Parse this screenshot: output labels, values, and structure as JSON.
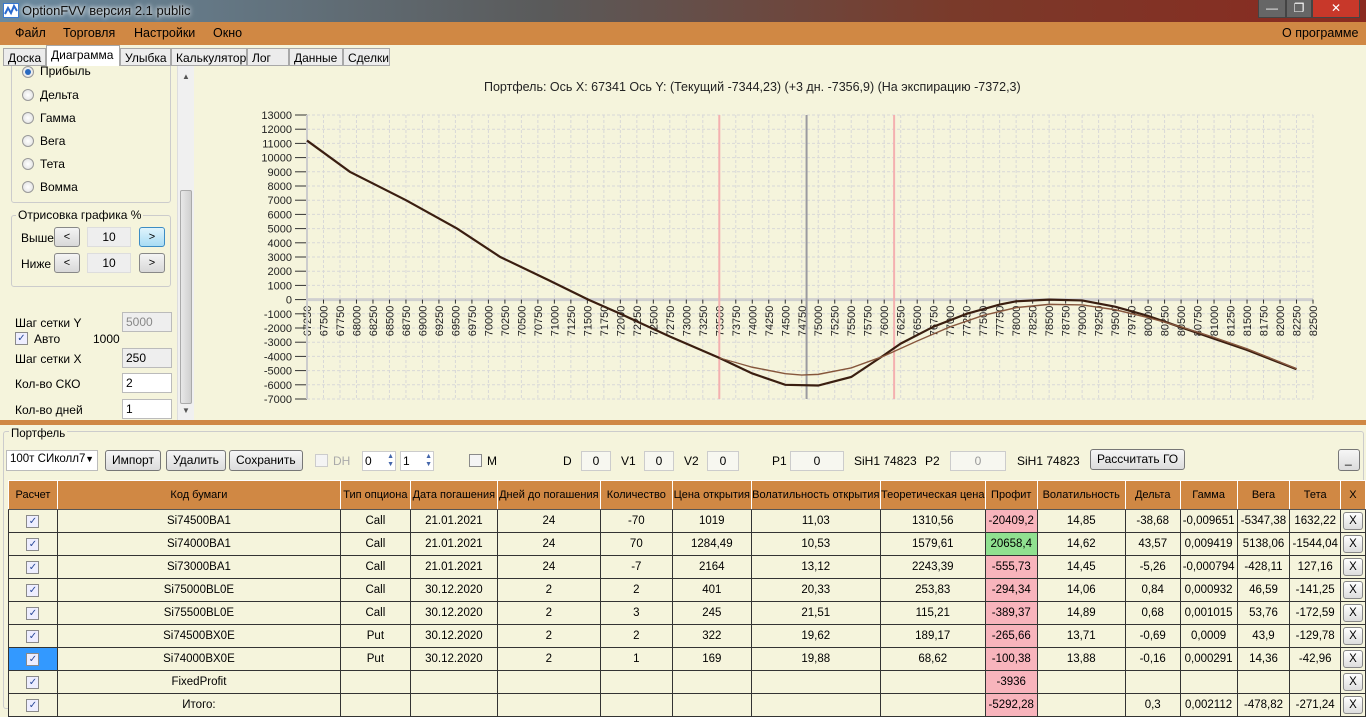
{
  "window": {
    "title": "OptionFVV версия 2.1 public",
    "icon": "app-chart-icon",
    "controls": [
      "minimize-icon",
      "maximize-icon",
      "close-icon"
    ]
  },
  "menu": {
    "items": [
      "Файл",
      "Торговля",
      "Настройки",
      "Окно"
    ],
    "about": "О программе"
  },
  "tabs": [
    "Доска",
    "Диаграмма",
    "Улыбка",
    "Калькулятор",
    "Лог",
    "Данные",
    "Сделки"
  ],
  "left": {
    "radios": [
      {
        "label": "Прибыль",
        "checked": true
      },
      {
        "label": "Дельта"
      },
      {
        "label": "Гамма"
      },
      {
        "label": "Вега"
      },
      {
        "label": "Тета"
      },
      {
        "label": "Вомма"
      }
    ],
    "draw_group": "Отрисовка графика %",
    "above": {
      "label": "Выше",
      "value": "10",
      "prev": "<",
      "next": ">"
    },
    "below": {
      "label": "Ниже",
      "value": "10",
      "prev": "<",
      "next": ">"
    },
    "grid_y": {
      "label": "Шаг сетки Y",
      "value": "5000"
    },
    "auto": {
      "label": "Авто",
      "value": "1000",
      "checked": true
    },
    "grid_x": {
      "label": "Шаг сетки X",
      "value": "250"
    },
    "sko": {
      "label": "Кол-во СКО",
      "value": "2"
    },
    "days": {
      "label": "Кол-во дней",
      "value": "1"
    }
  },
  "chart_header": "Портфель: Ось X: 67341 Ось Y:  (Текущий -7344,23)  (+3 дн. -7356,9)  (На экспирацию -7372,3)",
  "chart_data": {
    "type": "line",
    "title": "Портфель",
    "xlim": [
      67250,
      82500
    ],
    "xstep": 250,
    "ylim": [
      -7000,
      13000
    ],
    "ystep": 1000,
    "grid": true,
    "vlines": [
      {
        "x": 73500,
        "color": "#f4b0b0"
      },
      {
        "x": 74823,
        "color": "#9a9aa0"
      },
      {
        "x": 76150,
        "color": "#f4b0b0"
      }
    ],
    "series": [
      {
        "name": "На экспирацию",
        "color": "#3a1e10",
        "width": 2.2,
        "points": [
          [
            67250,
            11200
          ],
          [
            67900,
            9000
          ],
          [
            68750,
            7000
          ],
          [
            69525,
            5000
          ],
          [
            70180,
            3000
          ],
          [
            70900,
            1400
          ],
          [
            71514,
            0
          ],
          [
            72000,
            -1000
          ],
          [
            72750,
            -2600
          ],
          [
            73500,
            -4100
          ],
          [
            74000,
            -5200
          ],
          [
            74500,
            -6000
          ],
          [
            75000,
            -6050
          ],
          [
            75500,
            -5450
          ],
          [
            76000,
            -3900
          ],
          [
            76250,
            -3100
          ],
          [
            76750,
            -1900
          ],
          [
            77250,
            -1000
          ],
          [
            77750,
            -350
          ],
          [
            78000,
            -120
          ],
          [
            78500,
            0
          ],
          [
            79000,
            -60
          ],
          [
            79500,
            -500
          ],
          [
            80000,
            -1150
          ],
          [
            80500,
            -1950
          ],
          [
            81000,
            -2750
          ],
          [
            81500,
            -3550
          ],
          [
            82250,
            -4900
          ]
        ]
      },
      {
        "name": "Текущий",
        "color": "#7a4a30",
        "width": 1,
        "points": [
          [
            73500,
            -4100
          ],
          [
            74000,
            -4750
          ],
          [
            74500,
            -5200
          ],
          [
            74750,
            -5300
          ],
          [
            75000,
            -5250
          ],
          [
            75500,
            -4800
          ],
          [
            76000,
            -3950
          ],
          [
            76500,
            -2900
          ],
          [
            77000,
            -1900
          ],
          [
            77500,
            -1100
          ],
          [
            78000,
            -550
          ],
          [
            78500,
            -320
          ],
          [
            79000,
            -360
          ],
          [
            79500,
            -700
          ],
          [
            80000,
            -1250
          ],
          [
            80500,
            -1900
          ],
          [
            81000,
            -2650
          ],
          [
            81500,
            -3450
          ],
          [
            82250,
            -4850
          ]
        ]
      },
      {
        "name": "+3 дн.",
        "color": "#8a5a40",
        "width": 1,
        "points": [
          [
            73500,
            -4100
          ],
          [
            74000,
            -4780
          ],
          [
            74500,
            -5230
          ],
          [
            74750,
            -5330
          ],
          [
            75000,
            -5280
          ],
          [
            75500,
            -4830
          ],
          [
            76000,
            -3980
          ],
          [
            76500,
            -2930
          ],
          [
            77000,
            -1930
          ],
          [
            77500,
            -1130
          ],
          [
            78000,
            -580
          ],
          [
            78500,
            -350
          ],
          [
            79000,
            -390
          ],
          [
            79500,
            -730
          ],
          [
            80000,
            -1280
          ],
          [
            80500,
            -1930
          ],
          [
            81000,
            -2680
          ],
          [
            81500,
            -3480
          ],
          [
            82250,
            -4880
          ]
        ]
      }
    ]
  },
  "portfolio": {
    "group": "Портфель",
    "select": "100т СИколл7",
    "import": "Импорт",
    "delete": "Удалить",
    "save": "Сохранить",
    "dh": "DH",
    "spin1": "0",
    "spin2": "1",
    "m": "M",
    "d_label": "D",
    "d": "0",
    "v1_label": "V1",
    "v1": "0",
    "v2_label": "V2",
    "v2": "0",
    "p1_label": "P1",
    "p1": "0",
    "p1_sym": "SiH1 74823",
    "p2_label": "P2",
    "p2": "0",
    "p2_sym": "SiH1 74823",
    "calc_go": "Рассчитать ГО",
    "minimize": "_",
    "columns": [
      "Расчет",
      "Код бумаги",
      "Тип опциона",
      "Дата погашения",
      "Дней до погашения",
      "Количество",
      "Цена открытия",
      "Волатильность открытия",
      "Теоретическая цена",
      "Профит",
      "Волатильность",
      "Дельта",
      "Гамма",
      "Вега",
      "Тета",
      "X"
    ],
    "rows": [
      {
        "code": "Si74500BA1",
        "type": "Call",
        "date": "21.01.2021",
        "days": "24",
        "qty": "-70",
        "open": "1019",
        "vol_open": "11,03",
        "theo": "1310,56",
        "profit": "-20409,2",
        "vol": "14,85",
        "delta": "-38,68",
        "gamma": "-0,009651",
        "vega": "-5347,38",
        "theta": "1632,22",
        "x": "X"
      },
      {
        "code": "Si74000BA1",
        "type": "Call",
        "date": "21.01.2021",
        "days": "24",
        "qty": "70",
        "open": "1284,49",
        "vol_open": "10,53",
        "theo": "1579,61",
        "profit": "20658,4",
        "vol": "14,62",
        "delta": "43,57",
        "gamma": "0,009419",
        "vega": "5138,06",
        "theta": "-1544,04",
        "x": "X"
      },
      {
        "code": "Si73000BA1",
        "type": "Call",
        "date": "21.01.2021",
        "days": "24",
        "qty": "-7",
        "open": "2164",
        "vol_open": "13,12",
        "theo": "2243,39",
        "profit": "-555,73",
        "vol": "14,45",
        "delta": "-5,26",
        "gamma": "-0,000794",
        "vega": "-428,11",
        "theta": "127,16",
        "x": "X"
      },
      {
        "code": "Si75000BL0E",
        "type": "Call",
        "date": "30.12.2020",
        "days": "2",
        "qty": "2",
        "open": "401",
        "vol_open": "20,33",
        "theo": "253,83",
        "profit": "-294,34",
        "vol": "14,06",
        "delta": "0,84",
        "gamma": "0,000932",
        "vega": "46,59",
        "theta": "-141,25",
        "x": "X"
      },
      {
        "code": "Si75500BL0E",
        "type": "Call",
        "date": "30.12.2020",
        "days": "2",
        "qty": "3",
        "open": "245",
        "vol_open": "21,51",
        "theo": "115,21",
        "profit": "-389,37",
        "vol": "14,89",
        "delta": "0,68",
        "gamma": "0,001015",
        "vega": "53,76",
        "theta": "-172,59",
        "x": "X"
      },
      {
        "code": "Si74500BX0E",
        "type": "Put",
        "date": "30.12.2020",
        "days": "2",
        "qty": "2",
        "open": "322",
        "vol_open": "19,62",
        "theo": "189,17",
        "profit": "-265,66",
        "vol": "13,71",
        "delta": "-0,69",
        "gamma": "0,0009",
        "vega": "43,9",
        "theta": "-129,78",
        "x": "X"
      },
      {
        "code": "Si74000BX0E",
        "type": "Put",
        "date": "30.12.2020",
        "days": "2",
        "qty": "1",
        "open": "169",
        "vol_open": "19,88",
        "theo": "68,62",
        "profit": "-100,38",
        "vol": "13,88",
        "delta": "-0,16",
        "gamma": "0,000291",
        "vega": "14,36",
        "theta": "-42,96",
        "x": "X"
      },
      {
        "code": "FixedProfit",
        "type": "",
        "date": "",
        "days": "",
        "qty": "",
        "open": "",
        "vol_open": "",
        "theo": "",
        "profit": "-3936",
        "vol": "",
        "delta": "",
        "gamma": "",
        "vega": "",
        "theta": "",
        "x": "X"
      },
      {
        "code": "Итого:",
        "type": "",
        "date": "",
        "days": "",
        "qty": "",
        "open": "",
        "vol_open": "",
        "theo": "",
        "profit": "-5292,28",
        "vol": "",
        "delta": "0,3",
        "gamma": "0,002112",
        "vega": "-478,82",
        "theta": "-271,24",
        "x": "X"
      }
    ]
  },
  "colors": {
    "menu": "#d08844",
    "background": "#f5f4dc",
    "profit_negative": "#f8b4bc",
    "profit_positive": "#90e090",
    "selection": "#3399ff"
  }
}
